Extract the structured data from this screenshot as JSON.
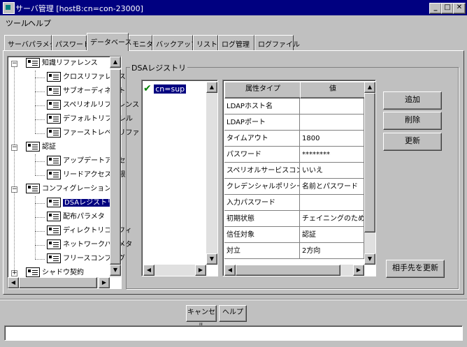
{
  "window": {
    "title": "サーバ管理 [hostB:cn=con-23000]"
  },
  "menu": [
    "ツール",
    "ヘルプ"
  ],
  "tabs": [
    "サーバパラメタ",
    "パスワード",
    "データベース",
    "モニター",
    "バックアップ",
    "リストア",
    "ログ管理",
    "ログファイル"
  ],
  "active_tab": 2,
  "tree": {
    "items": [
      {
        "label": "知識リファレンス",
        "level": 0,
        "expanded": true
      },
      {
        "label": "クロスリファレンス",
        "level": 1
      },
      {
        "label": "サブオーディネート",
        "level": 1
      },
      {
        "label": "スペリオルリファレンス",
        "level": 1
      },
      {
        "label": "デフォルトリファレル",
        "level": 1
      },
      {
        "label": "ファーストレベルリファ",
        "level": 1
      },
      {
        "label": "認証",
        "level": 0,
        "expanded": true
      },
      {
        "label": "アップデートアクセ",
        "level": 1
      },
      {
        "label": "リードアクセス制限",
        "level": 1
      },
      {
        "label": "コンフィグレーション",
        "level": 0,
        "expanded": true
      },
      {
        "label": "DSAレジストリ",
        "level": 1,
        "selected": true
      },
      {
        "label": "配布パラメタ",
        "level": 1
      },
      {
        "label": "ディレクトリコンフィ",
        "level": 1
      },
      {
        "label": "ネットワークパラメタ",
        "level": 1
      },
      {
        "label": "フリースコンフィグ",
        "level": 1
      },
      {
        "label": "シャドウ契約",
        "level": 0,
        "expanded": false
      }
    ]
  },
  "panel": {
    "group_title": "DSAレジストリ",
    "list": [
      {
        "label": "cn=sup",
        "checked": true
      }
    ],
    "table": {
      "headers": [
        "属性タイプ",
        "値"
      ],
      "rows": [
        [
          "LDAPホスト名",
          ""
        ],
        [
          "LDAPポート",
          ""
        ],
        [
          "タイムアウト",
          "1800"
        ],
        [
          "パスワード",
          "********"
        ],
        [
          "スペリオルサービスコンシューマ",
          "いいえ"
        ],
        [
          "クレデンシャルポリシー",
          "名前とパスワード"
        ],
        [
          "入力パスワード",
          ""
        ],
        [
          "初期状態",
          "チェイニングのために許"
        ],
        [
          "信任対象",
          "認証"
        ],
        [
          "対立",
          "2方向"
        ]
      ]
    },
    "buttons": {
      "add": "追加",
      "delete": "削除",
      "update": "更新",
      "refresh_peer": "相手先を更新"
    }
  },
  "footer": {
    "cancel": "キャンセル",
    "help": "ヘルプ",
    "status": ""
  },
  "colors": {
    "face": "#c0c0c0",
    "title": "#000080",
    "selection": "#000080",
    "check": "#008000"
  }
}
